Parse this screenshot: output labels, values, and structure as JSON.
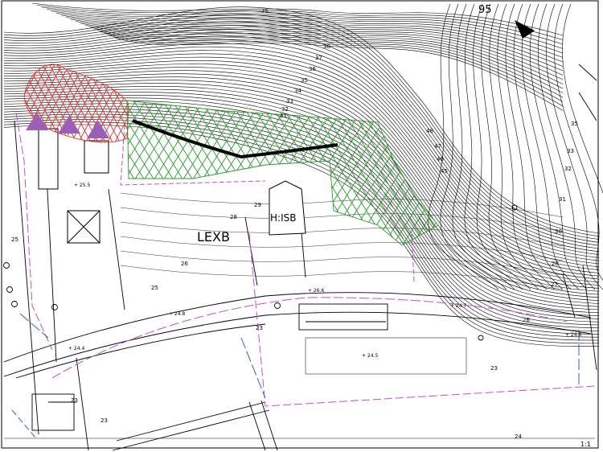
{
  "map": {
    "colors": {
      "background": "#ffffff",
      "contour": "#000000",
      "hatch_red": "#e0312c",
      "hatch_green": "#2e9a2e",
      "boundary_pink": "#c24fc7",
      "boundary_blue": "#2e5fd0",
      "marker_purple": "#9b5fb8"
    },
    "building_labels": [
      {
        "id": "lexb",
        "text": "LEXB"
      },
      {
        "id": "hisb",
        "text": "H:ISB"
      }
    ],
    "contour_labels": [
      {
        "id": "c75",
        "text": "75"
      },
      {
        "id": "c95",
        "text": "95"
      },
      {
        "id": "c38",
        "text": "38"
      },
      {
        "id": "c37",
        "text": "37"
      },
      {
        "id": "c36",
        "text": "36"
      },
      {
        "id": "c35",
        "text": "35"
      },
      {
        "id": "c34",
        "text": "34"
      },
      {
        "id": "c33",
        "text": "33"
      },
      {
        "id": "c32",
        "text": "32"
      },
      {
        "id": "c31",
        "text": "31"
      },
      {
        "id": "c48",
        "text": "48"
      },
      {
        "id": "c47",
        "text": "47"
      },
      {
        "id": "c46",
        "text": "46"
      },
      {
        "id": "c45",
        "text": "45"
      },
      {
        "id": "r35",
        "text": "35"
      },
      {
        "id": "r33",
        "text": "33"
      },
      {
        "id": "r32",
        "text": "32"
      },
      {
        "id": "r31",
        "text": "31"
      },
      {
        "id": "r30",
        "text": "30"
      },
      {
        "id": "r28",
        "text": "28"
      },
      {
        "id": "r27",
        "text": "27"
      },
      {
        "id": "r26",
        "text": "26"
      },
      {
        "id": "m29",
        "text": "29"
      },
      {
        "id": "m28",
        "text": "28"
      },
      {
        "id": "m25",
        "text": "25"
      },
      {
        "id": "m23",
        "text": "23"
      },
      {
        "id": "m26",
        "text": "26"
      },
      {
        "id": "l25",
        "text": "25"
      },
      {
        "id": "l23",
        "text": "23"
      },
      {
        "id": "b23",
        "text": "23"
      },
      {
        "id": "b23b",
        "text": "23"
      },
      {
        "id": "b24",
        "text": "24"
      }
    ],
    "spot_heights": [
      {
        "id": "s1",
        "text": "+ 25.5"
      },
      {
        "id": "s2",
        "text": "+ 24.8"
      },
      {
        "id": "s3",
        "text": "+ 24.4"
      },
      {
        "id": "s4",
        "text": "+ 26.6"
      },
      {
        "id": "s5",
        "text": "+ 24.7"
      },
      {
        "id": "s6",
        "text": "+ 24.5"
      },
      {
        "id": "s7",
        "text": "+ 24.8"
      }
    ],
    "scale_note": "1:1"
  }
}
